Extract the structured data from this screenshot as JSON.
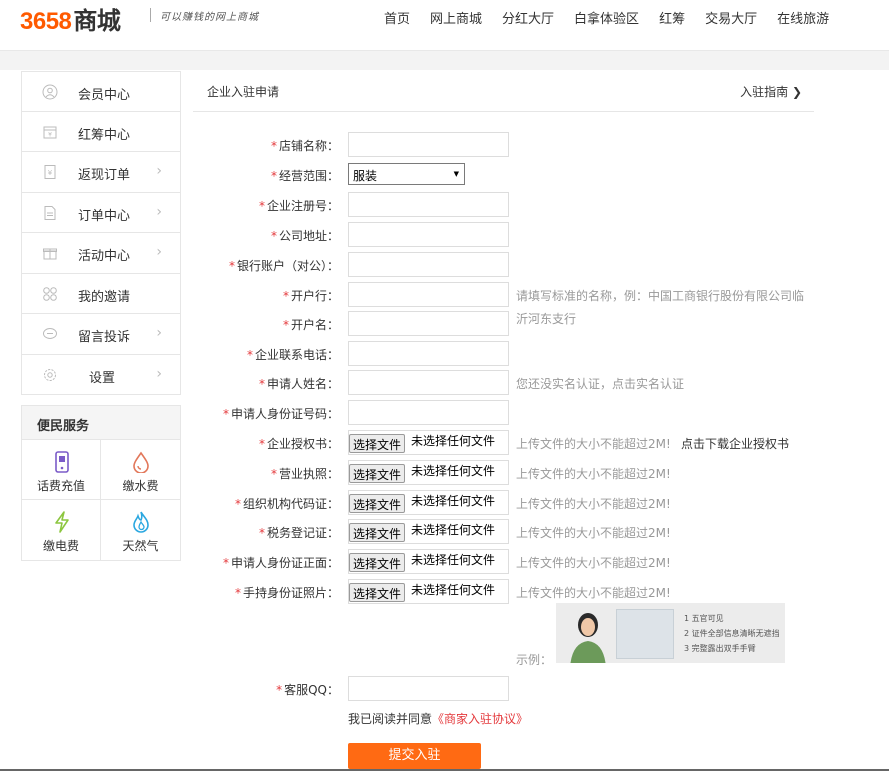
{
  "header": {
    "logo_number": "3658",
    "logo_text": "商城",
    "slogan": "可以赚钱的网上商城",
    "nav": [
      "首页",
      "网上商城",
      "分红大厅",
      "白拿体验区",
      "红筹",
      "交易大厅",
      "在线旅游"
    ]
  },
  "sidebar": {
    "items": [
      {
        "label": "会员中心",
        "icon": "user-icon",
        "arrow": ""
      },
      {
        "label": "红筹中心",
        "icon": "coin-icon",
        "arrow": ""
      },
      {
        "label": "返现订单",
        "icon": "yen-icon",
        "arrow": "›"
      },
      {
        "label": "订单中心",
        "icon": "document-icon",
        "arrow": "›"
      },
      {
        "label": "活动中心",
        "icon": "gift-icon",
        "arrow": "›"
      },
      {
        "label": "我的邀请",
        "icon": "circles-icon",
        "arrow": ""
      },
      {
        "label": "留言投诉",
        "icon": "chat-icon",
        "arrow": "›"
      },
      {
        "label": "设置",
        "icon": "gear-icon",
        "arrow": "›"
      }
    ]
  },
  "services": {
    "title": "便民服务",
    "items": [
      {
        "label": "话费充值",
        "icon": "phone-icon",
        "color": "#7b5cc8"
      },
      {
        "label": "缴水费",
        "icon": "water-drop-icon",
        "color": "#e2775a"
      },
      {
        "label": "缴电费",
        "icon": "lightning-icon",
        "color": "#8cc63f"
      },
      {
        "label": "天然气",
        "icon": "flame-icon",
        "color": "#2aa7e0"
      }
    ]
  },
  "main": {
    "title": "企业入驻申请",
    "guide": "入驻指南 ❯",
    "required_mark": "*",
    "fields": {
      "shop_name": "店铺名称：",
      "scope": "经营范围：",
      "scope_value": "服装",
      "reg_no": "企业注册号：",
      "address": "公司地址：",
      "bank_account": "银行账户（对公）：",
      "bank": "开户行：",
      "account_name": "开户名：",
      "phone": "企业联系电话：",
      "applicant": "申请人姓名：",
      "id_no": "申请人身份证号码：",
      "auth_letter": "企业授权书：",
      "license": "营业执照：",
      "org_code": "组织机构代码证：",
      "tax_reg": "税务登记证：",
      "id_front": "申请人身份证正面：",
      "id_hand": "手持身份证照片：",
      "qq": "客服QQ："
    },
    "hints": {
      "bank_line1": "请填写标准的名称，例：中国工商银行股份有限公司临",
      "bank_line2": "沂河东支行",
      "realname": "您还没实名认证，点击实名认证",
      "file_size": "上传文件的大小不能超过2M!",
      "download": "点击下载企业授权书",
      "example": "示例："
    },
    "file_button": "选择文件",
    "file_none": "未选择任何文件",
    "example_notes": [
      "1 五官可见",
      "2 证件全部信息清晰无遮挡",
      "3 完整露出双手手臂"
    ],
    "agree_text": "我已阅读并同意",
    "agree_link": "《商家入驻协议》",
    "submit": "提交入驻"
  }
}
